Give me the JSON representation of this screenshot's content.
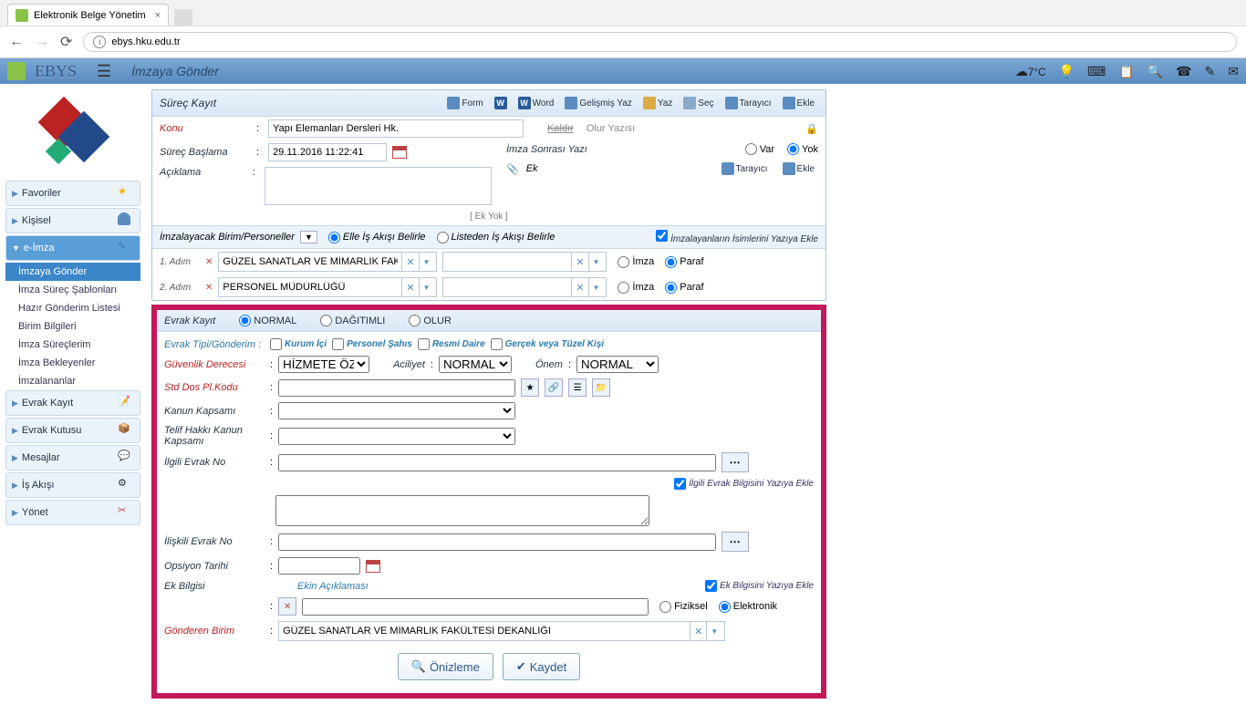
{
  "browser": {
    "tab_title": "Elektronik Belge Yönetim",
    "url": "ebys.hku.edu.tr"
  },
  "app": {
    "brand": "EBYS",
    "page_title": "İmzaya Gönder",
    "temp": "7°C"
  },
  "sidebar": {
    "favoriler": "Favoriler",
    "kisisel": "Kişisel",
    "eimza": "e-İmza",
    "sub": {
      "s1": "İmzaya Gönder",
      "s2": "İmza Süreç Şablonları",
      "s3": "Hazır Gönderim Listesi",
      "s4": "Birim Bilgileri",
      "s5": "İmza Süreçlerim",
      "s6": "İmza Bekleyenler",
      "s7": "İmzalananlar"
    },
    "evrak_kayit": "Evrak Kayıt",
    "evrak_kutusu": "Evrak Kutusu",
    "mesajlar": "Mesajlar",
    "is_akisi": "İş Akışı",
    "yonet": "Yönet"
  },
  "surec": {
    "title": "Süreç Kayıt",
    "tb": {
      "form": "Form",
      "word": "Word",
      "gelismis": "Gelişmiş Yaz",
      "yaz": "Yaz",
      "sec": "Seç",
      "tarayici": "Tarayıcı",
      "ekle": "Ekle"
    },
    "konu_lbl": "Konu",
    "konu_val": "Yapı Elemanları Dersleri Hk.",
    "kaldir": "Kaldır",
    "olur": "Olur Yazısı",
    "baslama_lbl": "Süreç Başlama",
    "baslama_val": "29.11.2016 11:22:41",
    "aciklama_lbl": "Açıklama",
    "imza_sonrasi": "İmza Sonrası Yazı",
    "var": "Var",
    "yok": "Yok",
    "ek_lbl": "Ek",
    "tarayici2": "Tarayıcı",
    "ekle2": "Ekle",
    "ek_yok": "[ Ek Yok ]",
    "imzalayacak": "İmzalayacak Birim/Personeller",
    "elle": "Elle İş Akışı Belirle",
    "listeden": "Listeden İş Akışı Belirle",
    "isim_ekle": "İmzalayanların İsimlerini Yazıya Ekle",
    "adim1": "1. Adım",
    "adim2": "2. Adım",
    "birim1": "GÜZEL SANATLAR VE MİMARLIK FAKÜLTESİ DEKA",
    "birim2": "PERSONEL MÜDÜRLÜĞÜ",
    "imza": "İmza",
    "paraf": "Paraf"
  },
  "evrak": {
    "title": "Evrak Kayıt",
    "normal": "NORMAL",
    "dagitimli": "DAĞITIMLI",
    "olur": "OLUR",
    "tipi_lbl": "Evrak Tipi/Gönderim :",
    "kurum": "Kurum İçi",
    "personel": "Personel Şahıs",
    "resmi": "Resmi Daire",
    "gercek": "Gerçek veya Tüzel Kişi",
    "guvenlik_lbl": "Güvenlik Derecesi",
    "guvenlik_val": "HİZMETE ÖZEL",
    "aciliyet_lbl": "Aciliyet",
    "aciliyet_val": "NORMAL",
    "onem_lbl": "Önem",
    "onem_val": "NORMAL",
    "std_lbl": "Std Dos Pl.Kodu",
    "kanun_lbl": "Kanun Kapsamı",
    "telif_lbl": "Telif Hakkı Kanun Kapsamı",
    "ilgili_lbl": "İlgili Evrak No",
    "ilgili_cb": "İlgili Evrak Bilgisini Yazıya Ekle",
    "iliskili_lbl": "İlişkili Evrak No",
    "opsiyon_lbl": "Opsiyon Tarihi",
    "ek_bilgisi_lbl": "Ek Bilgisi",
    "ekin_lbl": "Ekin Açıklaması",
    "ek_yaziya": "Ek Bilgisini Yazıya Ekle",
    "fiziksel": "Fiziksel",
    "elektronik": "Elektronik",
    "gonderen_lbl": "Gönderen Birim",
    "gonderen_val": "GÜZEL SANATLAR VE MİMARLIK FAKÜLTESİ DEKANLIĞI",
    "onizleme": "Önizleme",
    "kaydet": "Kaydet"
  }
}
